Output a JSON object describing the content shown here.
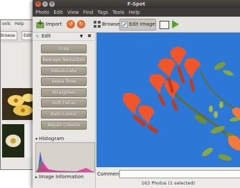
{
  "back_window": {
    "menu": [
      "ools",
      "Help"
    ],
    "tabs": [
      "Browse",
      "Edit"
    ]
  },
  "window": {
    "title": "F-Spot"
  },
  "menubar": [
    "Photo",
    "Edit",
    "View",
    "Find",
    "Tags",
    "Tools",
    "Help"
  ],
  "toolbar": {
    "import": "Import",
    "browse": "Browse",
    "edit_image": "Edit Image"
  },
  "sidebar": {
    "title": "Edit",
    "tools": [
      "Crop",
      "Red-eye Reduction",
      "Desaturate",
      "Sepia Tone",
      "Straighten",
      "Soft Focus",
      "Auto Colour",
      "Adjust Colours"
    ],
    "histogram": "Histogram",
    "image_information": "Image Information"
  },
  "comment": {
    "label": "Comment:",
    "value": ""
  },
  "status": "163 Photos (1 selected)"
}
